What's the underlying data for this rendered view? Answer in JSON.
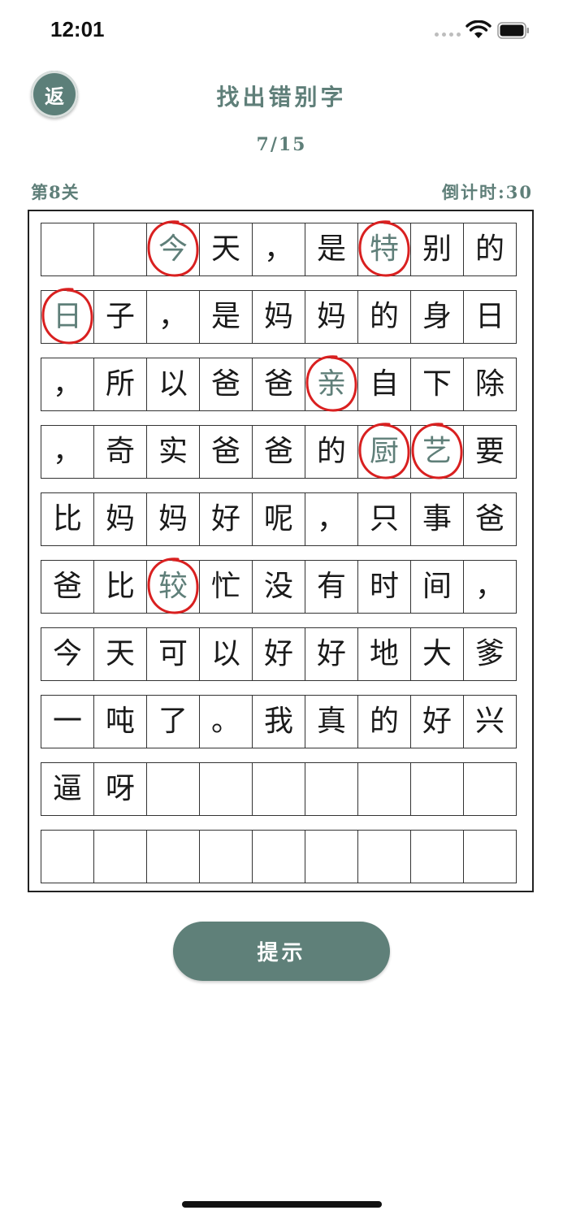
{
  "status_bar": {
    "time": "12:01",
    "icons": [
      "signal-icon",
      "wifi-icon",
      "battery-icon"
    ]
  },
  "header": {
    "back_label": "返",
    "title": "找出错别字",
    "progress": "7/15"
  },
  "info": {
    "level": "第8关",
    "countdown": "倒计时:30"
  },
  "grid": {
    "rows": [
      [
        "",
        "",
        "今",
        "天",
        "，",
        "是",
        "特",
        "别",
        "的"
      ],
      [
        "日",
        "子",
        "，",
        "是",
        "妈",
        "妈",
        "的",
        "身",
        "日"
      ],
      [
        "，",
        "所",
        "以",
        "爸",
        "爸",
        "亲",
        "自",
        "下",
        "除"
      ],
      [
        "，",
        "奇",
        "实",
        "爸",
        "爸",
        "的",
        "厨",
        "艺",
        "要"
      ],
      [
        "比",
        "妈",
        "妈",
        "好",
        "呢",
        "，",
        "只",
        "事",
        "爸"
      ],
      [
        "爸",
        "比",
        "较",
        "忙",
        "没",
        "有",
        "时",
        "间",
        "，"
      ],
      [
        "今",
        "天",
        "可",
        "以",
        "好",
        "好",
        "地",
        "大",
        "爹"
      ],
      [
        "一",
        "吨",
        "了",
        "。",
        "我",
        "真",
        "的",
        "好",
        "兴"
      ],
      [
        "逼",
        "呀",
        "",
        "",
        "",
        "",
        "",
        "",
        ""
      ],
      [
        "",
        "",
        "",
        "",
        "",
        "",
        "",
        "",
        ""
      ]
    ],
    "found_marks": [
      {
        "row": 0,
        "col": 2
      },
      {
        "row": 0,
        "col": 6
      },
      {
        "row": 1,
        "col": 0
      },
      {
        "row": 2,
        "col": 5
      },
      {
        "row": 3,
        "col": 6
      },
      {
        "row": 3,
        "col": 7
      },
      {
        "row": 5,
        "col": 2
      }
    ],
    "mark_color": "#d92020",
    "found_char_color": "#5f7f79"
  },
  "hint_button": {
    "label": "提示"
  },
  "colors": {
    "accent": "#5f8079",
    "text_accent": "#5f7f79"
  }
}
